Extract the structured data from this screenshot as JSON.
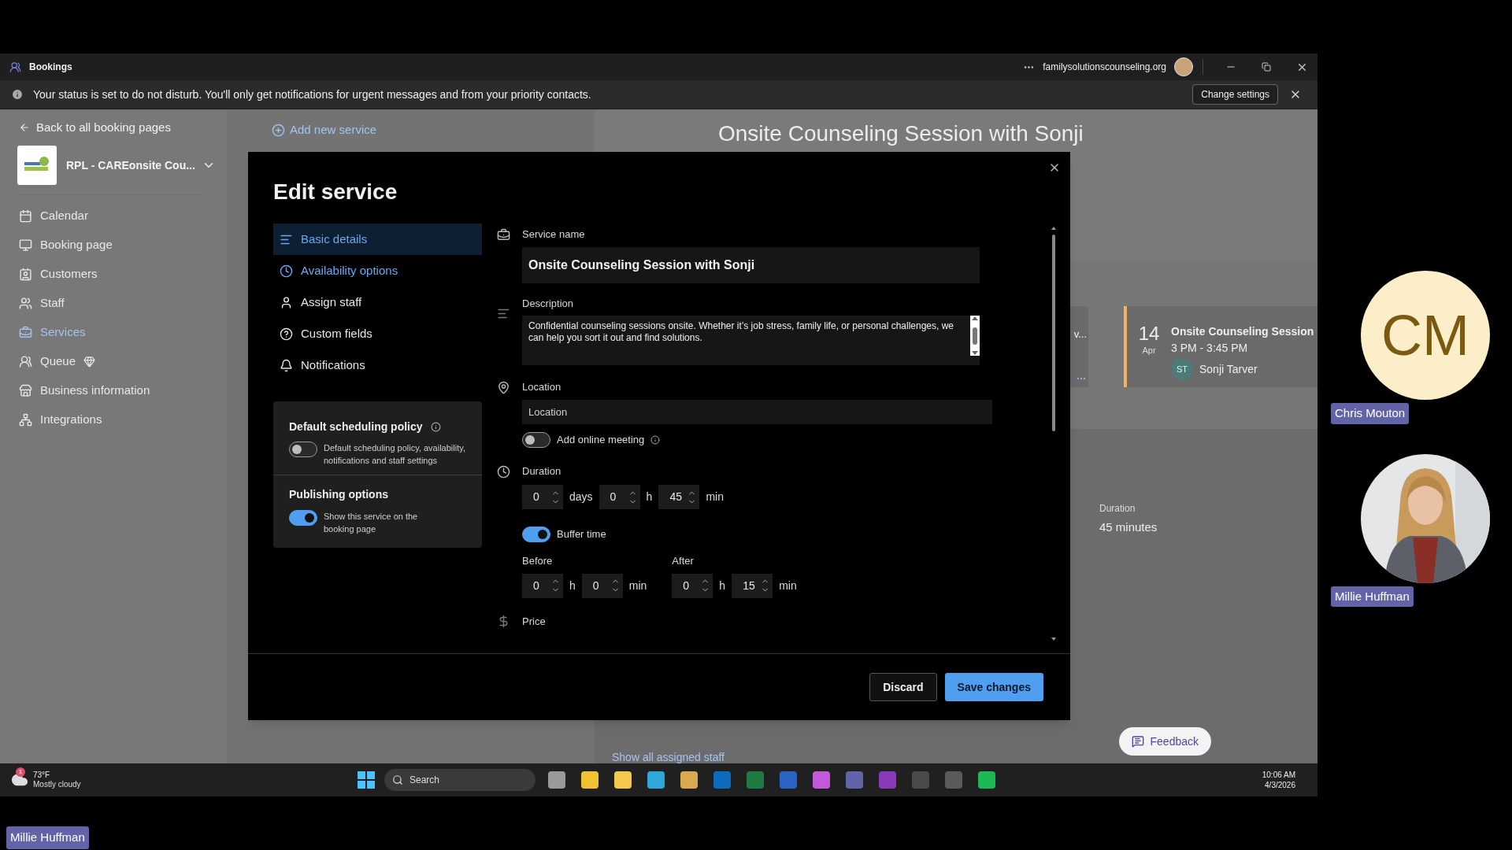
{
  "window": {
    "title": "Bookings",
    "account": "familysolutionscounseling.org"
  },
  "notification": {
    "message": "Your status is set to do not disturb. You'll only get notifications for urgent messages and from your priority contacts.",
    "action": "Change settings"
  },
  "sidebar": {
    "back_link": "Back to all booking pages",
    "business": "RPL - CAREonsite Cou...",
    "items": [
      {
        "label": "Calendar",
        "selected": false,
        "premium": false
      },
      {
        "label": "Booking page",
        "selected": false,
        "premium": false
      },
      {
        "label": "Customers",
        "selected": false,
        "premium": false
      },
      {
        "label": "Staff",
        "selected": false,
        "premium": false
      },
      {
        "label": "Services",
        "selected": true,
        "premium": false
      },
      {
        "label": "Queue",
        "selected": false,
        "premium": true
      },
      {
        "label": "Business information",
        "selected": false,
        "premium": false
      },
      {
        "label": "Integrations",
        "selected": false,
        "premium": false
      }
    ]
  },
  "main": {
    "add_service": "Add new service",
    "service_title": "Onsite Counseling Session with Sonji",
    "appointment_cards": [
      {
        "kind": "partial",
        "title": "v..."
      },
      {
        "kind": "full",
        "day": "14",
        "month": "Apr",
        "title": "Onsite Counseling Session",
        "time": "3 PM - 3:45 PM",
        "staff_initials": "ST",
        "staff_name": "Sonji Tarver"
      }
    ],
    "duration_label": "Duration",
    "duration_value": "45 minutes",
    "show_staff_link": "Show all assigned staff",
    "feedback": "Feedback"
  },
  "dialog": {
    "title": "Edit service",
    "nav": [
      {
        "label": "Basic details",
        "selected": true,
        "highlighted": true
      },
      {
        "label": "Availability options",
        "selected": false,
        "highlighted": true
      },
      {
        "label": "Assign staff",
        "selected": false,
        "highlighted": false
      },
      {
        "label": "Custom fields",
        "selected": false,
        "highlighted": false
      },
      {
        "label": "Notifications",
        "selected": false,
        "highlighted": false
      }
    ],
    "policy": {
      "title": "Default scheduling policy",
      "on": false,
      "description": "Default scheduling policy, availability, notifications and staff settings"
    },
    "publishing": {
      "title": "Publishing options",
      "on": true,
      "description": "Show this service on the booking page"
    },
    "form": {
      "service_name": {
        "label": "Service name",
        "value": "Onsite Counseling Session with Sonji"
      },
      "description": {
        "label": "Description",
        "value": "Confidential counseling sessions onsite. Whether it’s job stress, family life, or personal challenges, we can help you sort it out and find solutions."
      },
      "location": {
        "label": "Location",
        "placeholder": "Location"
      },
      "online_meeting": {
        "label": "Add online meeting",
        "on": false
      },
      "duration": {
        "label": "Duration",
        "fields": [
          {
            "value": "0",
            "unit": "days"
          },
          {
            "value": "0",
            "unit": "h"
          },
          {
            "value": "45",
            "unit": "min"
          }
        ]
      },
      "buffer": {
        "label": "Buffer time",
        "on": true,
        "groups": [
          {
            "label": "Before",
            "fields": [
              {
                "value": "0",
                "unit": "h"
              },
              {
                "value": "0",
                "unit": "min"
              }
            ]
          },
          {
            "label": "After",
            "fields": [
              {
                "value": "0",
                "unit": "h"
              },
              {
                "value": "15",
                "unit": "min"
              }
            ]
          }
        ]
      },
      "price": {
        "label": "Price"
      }
    },
    "buttons": {
      "discard": "Discard",
      "save": "Save changes"
    }
  },
  "taskbar": {
    "weather": {
      "badge": "1",
      "temp": "73°F",
      "condition": "Mostly cloudy"
    },
    "search": "Search",
    "time": "10:06 AM",
    "date": "4/3/2026"
  },
  "participants": [
    {
      "kind": "initials",
      "initials": "CM",
      "name": "Chris Mouton"
    },
    {
      "name": "Millie Huffman"
    }
  ],
  "presenter": "Millie Huffman"
}
